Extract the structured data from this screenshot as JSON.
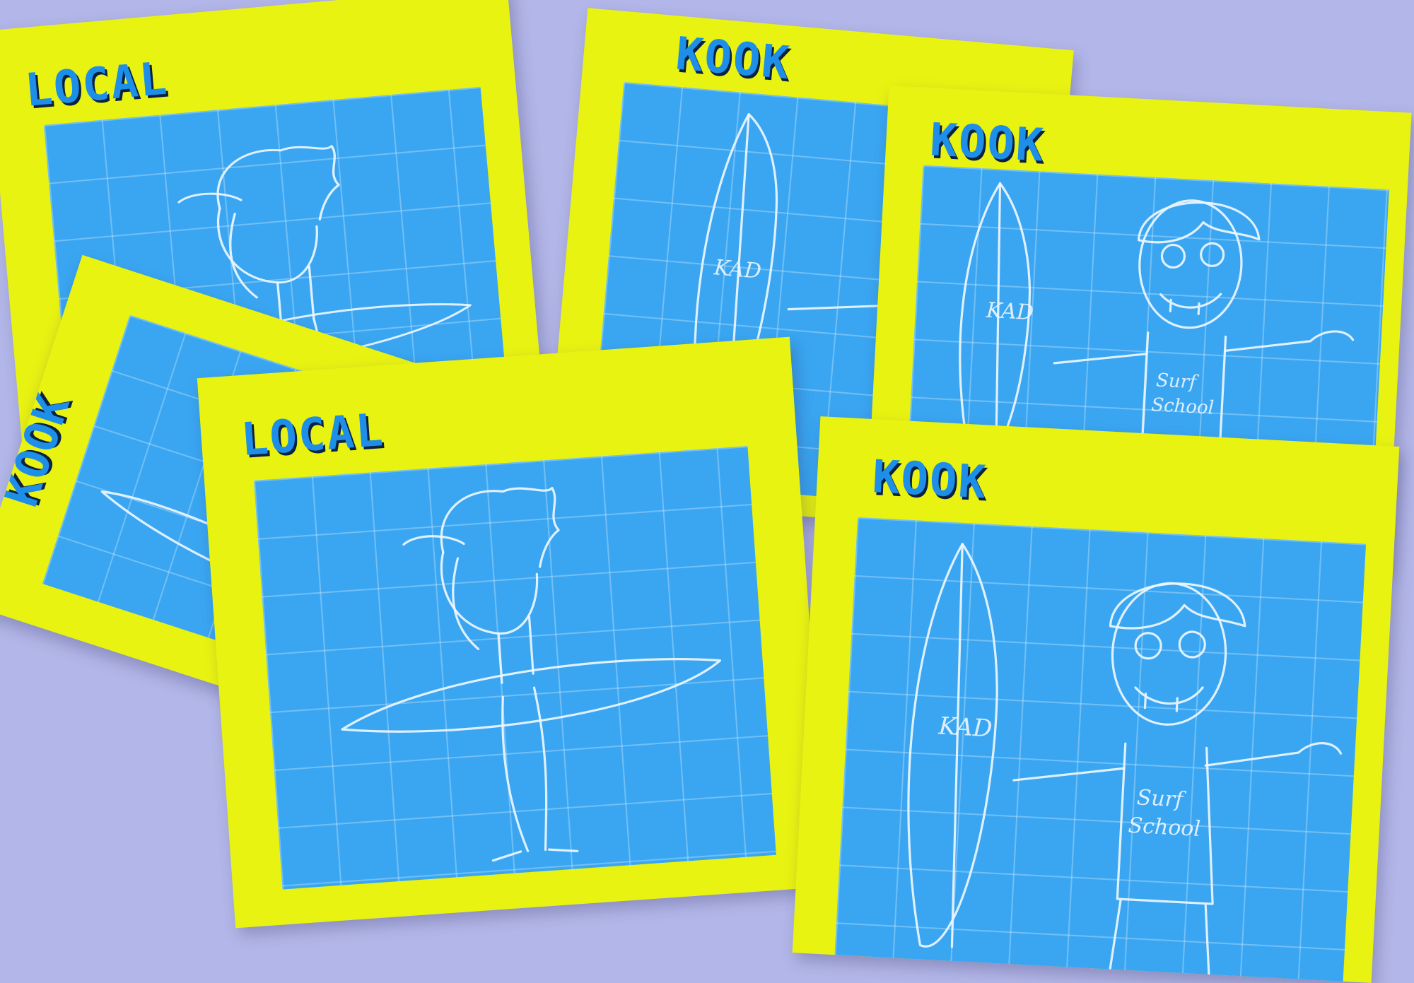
{
  "scene": {
    "background_color": "#b3b6e8",
    "card_color": "#e9f312",
    "art_color": "#3aa6f2",
    "title_color": "#1e8fe8"
  },
  "cards": [
    {
      "title": "LOCAL",
      "character": "local"
    },
    {
      "title": "KOOK",
      "character": "kook"
    },
    {
      "title": "KOOK",
      "character": "kook"
    },
    {
      "title": "KOOK",
      "character": "kook"
    },
    {
      "title": "LOCAL",
      "character": "local"
    },
    {
      "title": "KOOK",
      "character": "kook"
    }
  ],
  "shirt_text": [
    "Surf",
    "School"
  ],
  "board_logo": "KAD"
}
